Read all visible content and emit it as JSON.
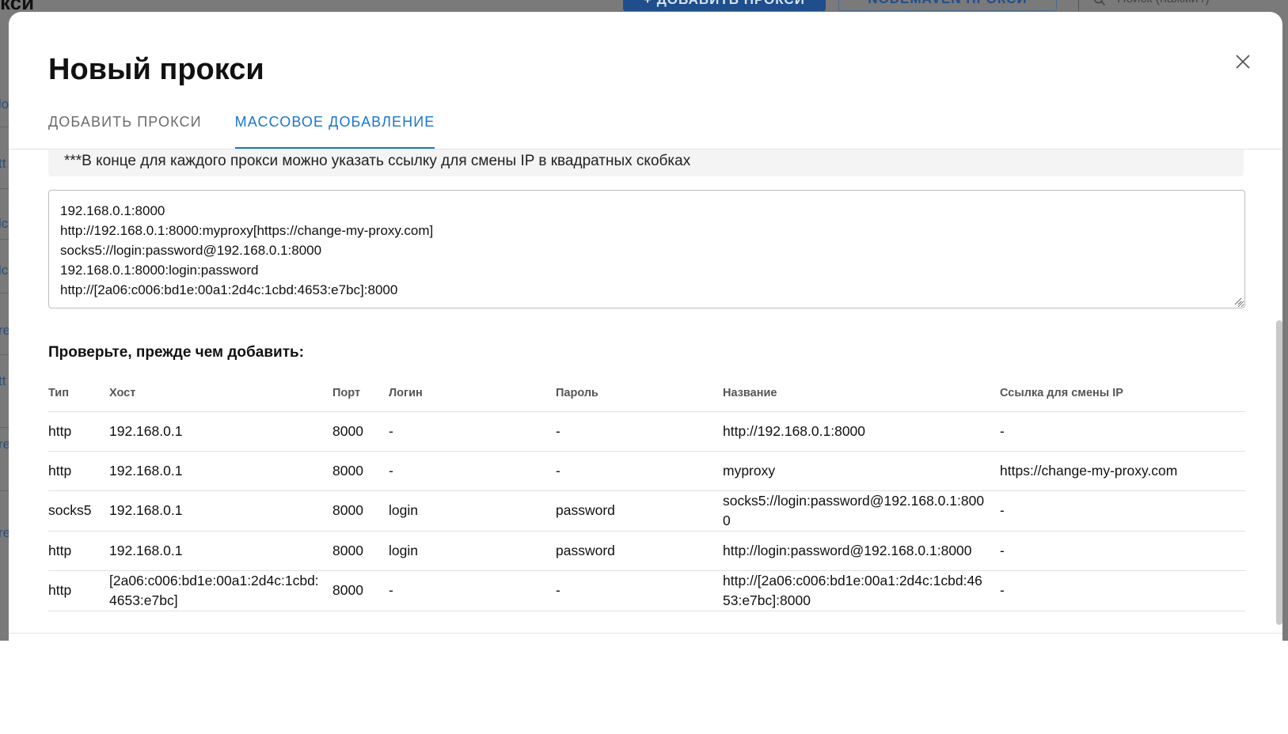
{
  "background": {
    "title": "кси",
    "primary_button": "+ ДОБАВИТЬ ПРОКСИ",
    "secondary_button": "NODEMAVEN ПРОКСИ",
    "search_placeholder": "Поиск (нажми /)",
    "side_fragments": [
      "lo",
      "tt",
      "lc",
      "lc",
      "re",
      "tt",
      "re",
      "re"
    ]
  },
  "modal": {
    "title": "Новый прокси",
    "tabs": [
      {
        "label": "ДОБАВИТЬ ПРОКСИ",
        "active": false
      },
      {
        "label": "МАССОВОЕ ДОБАВЛЕНИЕ",
        "active": true
      }
    ],
    "note": "***В конце для каждого прокси можно указать ссылку для смены IP в квадратных скобках",
    "textarea_lines": [
      "192.168.0.1:8000",
      "http://192.168.0.1:8000:myproxy[https://change-my-proxy.com]",
      "socks5://login:password@192.168.0.1:8000",
      "192.168.0.1:8000:login:password",
      "http://[2a06:c006:bd1e:00a1:2d4c:1cbd:4653:e7bc]:8000"
    ],
    "check_title": "Проверьте, прежде чем добавить:",
    "table": {
      "headers": [
        "Тип",
        "Хост",
        "Порт",
        "Логин",
        "Пароль",
        "Название",
        "Ссылка для смены IP"
      ],
      "rows": [
        [
          "http",
          "192.168.0.1",
          "8000",
          "-",
          "-",
          "http://192.168.0.1:8000",
          "-"
        ],
        [
          "http",
          "192.168.0.1",
          "8000",
          "-",
          "-",
          "myproxy",
          "https://change-my-proxy.com"
        ],
        [
          "socks5",
          "192.168.0.1",
          "8000",
          "login",
          "password",
          "socks5://login:password@192.168.0.1:8000",
          "-"
        ],
        [
          "http",
          "192.168.0.1",
          "8000",
          "login",
          "password",
          "http://login:password@192.168.0.1:8000",
          "-"
        ],
        [
          "http",
          "[2a06:c006:bd1e:00a1:2d4c:1cbd:4653:e7bc]",
          "8000",
          "-",
          "-",
          "http://[2a06:c006:bd1e:00a1:2d4c:1cbd:4653:e7bc]:8000",
          "-"
        ]
      ]
    }
  },
  "colors": {
    "accent": "#1976d2",
    "overlay": "#7a7a7a",
    "brand_dark": "#1e4e8c"
  },
  "icons": {
    "close": "close-icon",
    "search": "search-icon",
    "resize": "resize-handle-icon"
  }
}
